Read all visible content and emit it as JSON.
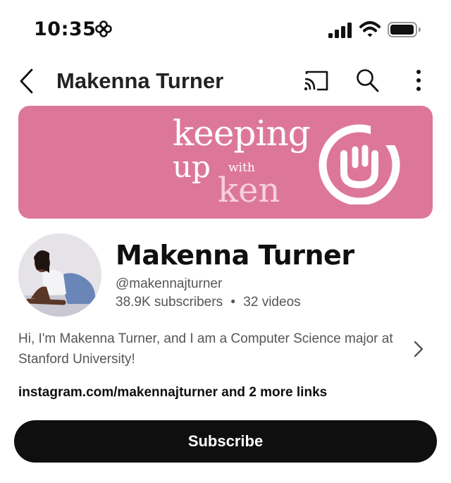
{
  "status_bar": {
    "time": "10:35",
    "icons": [
      "focus-icon",
      "signal-icon",
      "wifi-icon",
      "battery-icon"
    ]
  },
  "top_bar": {
    "title": "Makenna Turner",
    "icons": [
      "back-icon",
      "cast-icon",
      "search-icon",
      "more-icon"
    ]
  },
  "banner": {
    "line1": "keeping",
    "line2": "up",
    "line3": "with",
    "line4": "ken",
    "color": "#dd7799",
    "logo": "smiley-icon"
  },
  "channel": {
    "name": "Makenna Turner",
    "handle": "@makennajturner",
    "subscribers": "38.9K subscribers",
    "separator": "•",
    "videos": "32 videos",
    "description": "Hi, I'm Makenna Turner, and I am a Computer Science major at Stanford University!",
    "links": "instagram.com/makennajturner and 2 more links"
  },
  "actions": {
    "subscribe_label": "Subscribe"
  }
}
